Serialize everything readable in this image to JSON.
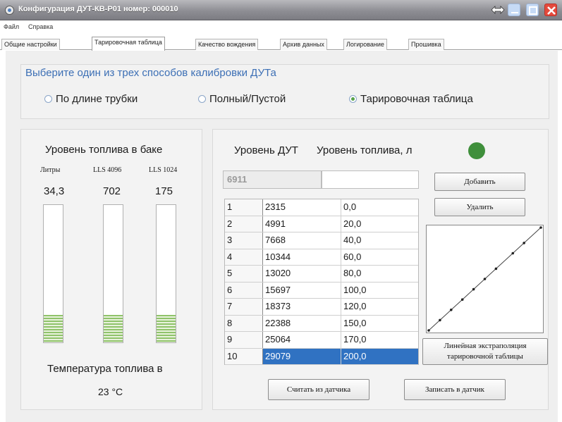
{
  "window": {
    "title": "Конфигурация ДУТ-КВ-Р01 номер: 000010"
  },
  "menu": [
    "Файл",
    "Справка"
  ],
  "tabs": [
    {
      "label": "Общие настройки"
    },
    {
      "label": "Тарировочная таблица"
    },
    {
      "label": "Качество вождения"
    },
    {
      "label": "Архив данных"
    },
    {
      "label": "Логирование"
    },
    {
      "label": "Прошивка"
    }
  ],
  "active_tab": 1,
  "calibration": {
    "title": "Выберите один из трех способов калибровки ДУТа",
    "options": [
      {
        "label": "По длине трубки",
        "checked": false
      },
      {
        "label": "Полный/Пустой",
        "checked": false
      },
      {
        "label": "Тарировочная таблица",
        "checked": true
      }
    ]
  },
  "fuel_level": {
    "title": "Уровень топлива в баке",
    "columns": [
      {
        "label": "Литры",
        "value": "34,3",
        "fill": 0.2
      },
      {
        "label": "LLS 4096",
        "value": "702",
        "fill": 0.2
      },
      {
        "label": "LLS 1024",
        "value": "175",
        "fill": 0.2
      }
    ],
    "temperature_label": "Температура топлива в",
    "temperature_value": "23 °С"
  },
  "table_panel": {
    "header_level": "Уровень ДУТ",
    "header_fuel": "Уровень топлива, л",
    "status_color": "#3f8f3b",
    "level_input": "6911",
    "fuel_input": "",
    "add_button": "Добавить",
    "delete_button": "Удалить",
    "extrapolation_button": [
      "Линейная экстраполяция",
      "тарировочной таблицы"
    ],
    "read_button": "Считать из датчика",
    "write_button": "Записать в датчик",
    "selected_row": 10,
    "rows": [
      {
        "n": "1",
        "level": "2315",
        "fuel": "0,0"
      },
      {
        "n": "2",
        "level": "4991",
        "fuel": "20,0"
      },
      {
        "n": "3",
        "level": "7668",
        "fuel": "40,0"
      },
      {
        "n": "4",
        "level": "10344",
        "fuel": "60,0"
      },
      {
        "n": "5",
        "level": "13020",
        "fuel": "80,0"
      },
      {
        "n": "6",
        "level": "15697",
        "fuel": "100,0"
      },
      {
        "n": "7",
        "level": "18373",
        "fuel": "120,0"
      },
      {
        "n": "8",
        "level": "22388",
        "fuel": "150,0"
      },
      {
        "n": "9",
        "level": "25064",
        "fuel": "170,0"
      },
      {
        "n": "10",
        "level": "29079",
        "fuel": "200,0"
      }
    ]
  },
  "chart_data": {
    "type": "line",
    "x": [
      2315,
      4991,
      7668,
      10344,
      13020,
      15697,
      18373,
      22388,
      25064,
      29079
    ],
    "values": [
      0,
      20,
      40,
      60,
      80,
      100,
      120,
      150,
      170,
      200
    ]
  }
}
